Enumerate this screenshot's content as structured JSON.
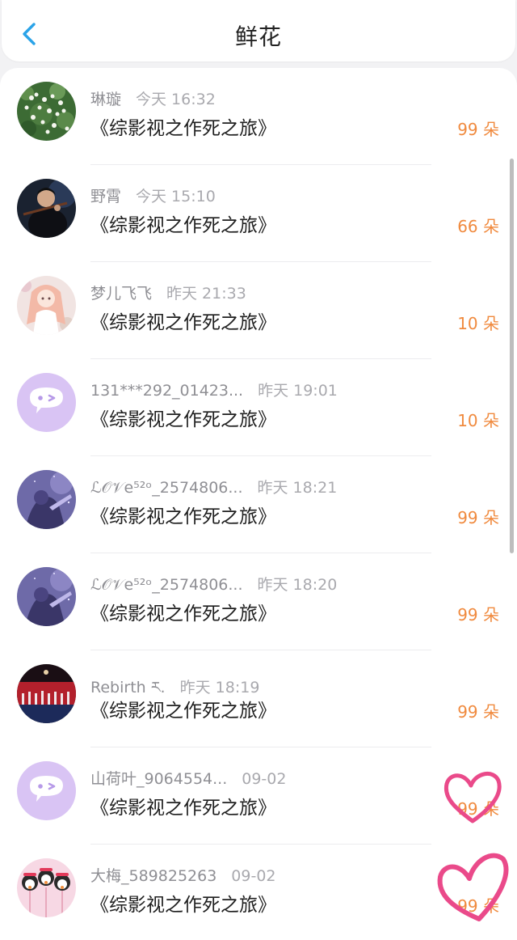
{
  "header": {
    "title": "鲜花",
    "back_icon": "chevron-left-icon",
    "accent_color": "#2aa3e8"
  },
  "colors": {
    "count": "#f08a3e",
    "name": "#8f8f94",
    "doodle": "#ea4a8a"
  },
  "rows": [
    {
      "name": "琳璇",
      "time": "今天 16:32",
      "book": "《综影视之作死之旅》",
      "count": "99 朵",
      "avatar": "white-flowers-photo"
    },
    {
      "name": "野霄",
      "time": "今天 15:10",
      "book": "《综影视之作死之旅》",
      "count": "66 朵",
      "avatar": "violinist-photo"
    },
    {
      "name": "梦儿飞飞",
      "time": "昨天 21:33",
      "book": "《综影视之作死之旅》",
      "count": "10 朵",
      "avatar": "anime-girl-pink-hair"
    },
    {
      "name": "131***292_01423...",
      "time": "昨天 19:01",
      "book": "《综影视之作死之旅》",
      "count": "10 朵",
      "avatar": "default-chat-bubble"
    },
    {
      "name": "ℒ𝒪𝒱e⁵²ᵒ_2574806...",
      "time": "昨天 18:21",
      "book": "《综影视之作死之旅》",
      "count": "99 朵",
      "avatar": "purple-night-character"
    },
    {
      "name": "ℒ𝒪𝒱e⁵²ᵒ_2574806...",
      "time": "昨天 18:20",
      "book": "《综影视之作死之旅》",
      "count": "99 朵",
      "avatar": "purple-night-character"
    },
    {
      "name": "Rebirth ར.",
      "time": "昨天 18:19",
      "book": "《综影视之作死之旅》",
      "count": "99 朵",
      "avatar": "stage-performance-photo"
    },
    {
      "name": "山荷叶_9064554...",
      "time": "09-02",
      "book": "《综影视之作死之旅》",
      "count": "99 朵",
      "avatar": "default-chat-bubble"
    },
    {
      "name": "大梅_589825263",
      "time": "09-02",
      "book": "《综影视之作死之旅》",
      "count": "99 朵",
      "avatar": "penguin-lollipops"
    }
  ]
}
